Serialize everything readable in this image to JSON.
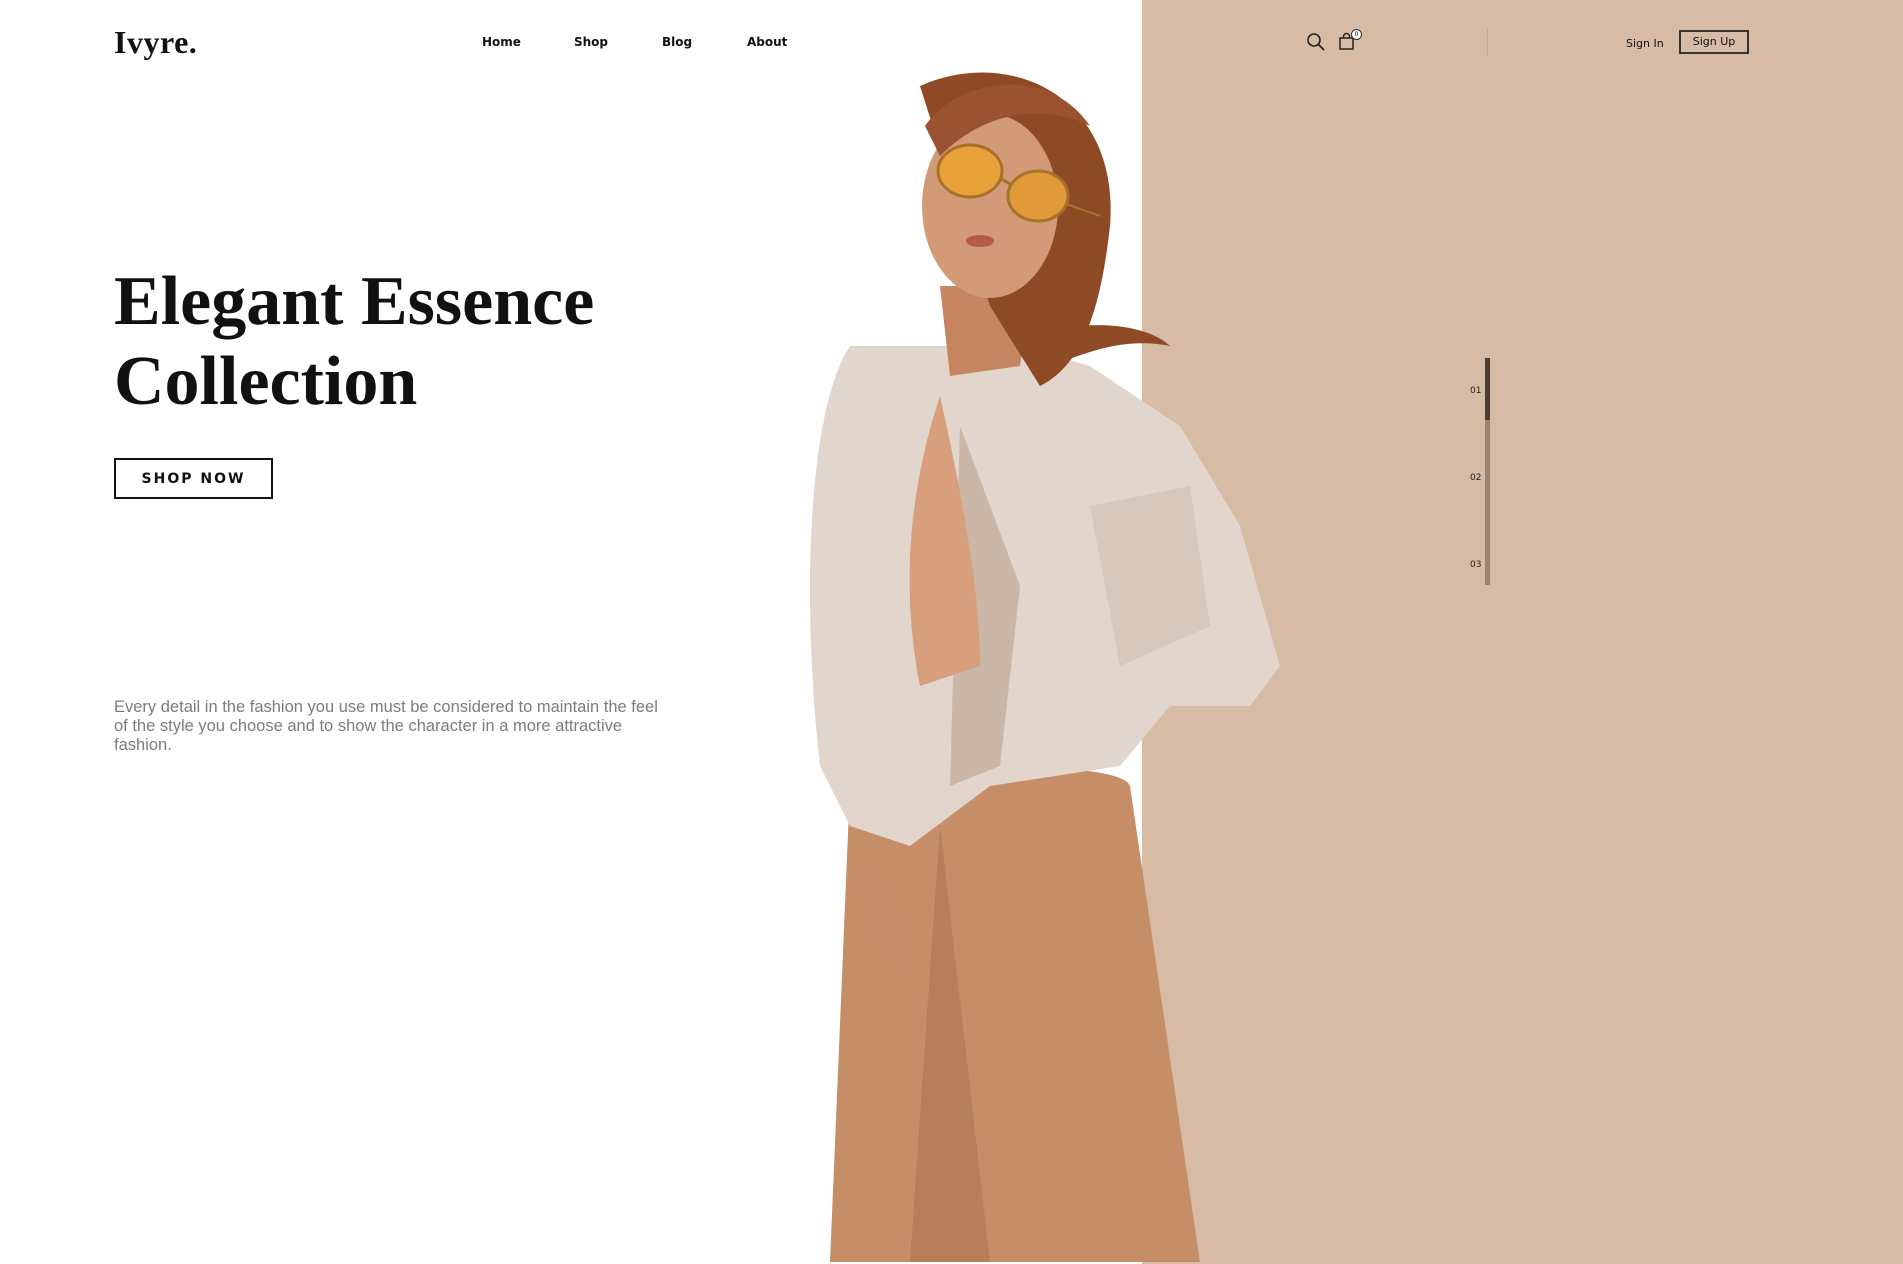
{
  "brand": {
    "logo": "Ivyre."
  },
  "nav": [
    {
      "label": "Home"
    },
    {
      "label": "Shop"
    },
    {
      "label": "Blog"
    },
    {
      "label": "About"
    }
  ],
  "header_actions": {
    "search_icon": "search-icon",
    "cart_icon": "shopping-bag-icon",
    "cart_count": "0",
    "sign_in": "Sign In",
    "sign_up": "Sign Up"
  },
  "hero": {
    "title_line1": "Elegant Essence",
    "title_line2": "Collection",
    "cta": "SHOP NOW",
    "description": "Every detail in the fashion you use must be considered to maintain the feel of the style you choose and to show the character in a more attractive fashion."
  },
  "slider": {
    "items": [
      "01",
      "02",
      "03"
    ],
    "active_index": 0
  },
  "colors": {
    "panel": "#d6bca5",
    "text": "#111111",
    "muted": "#7c7c7c"
  }
}
